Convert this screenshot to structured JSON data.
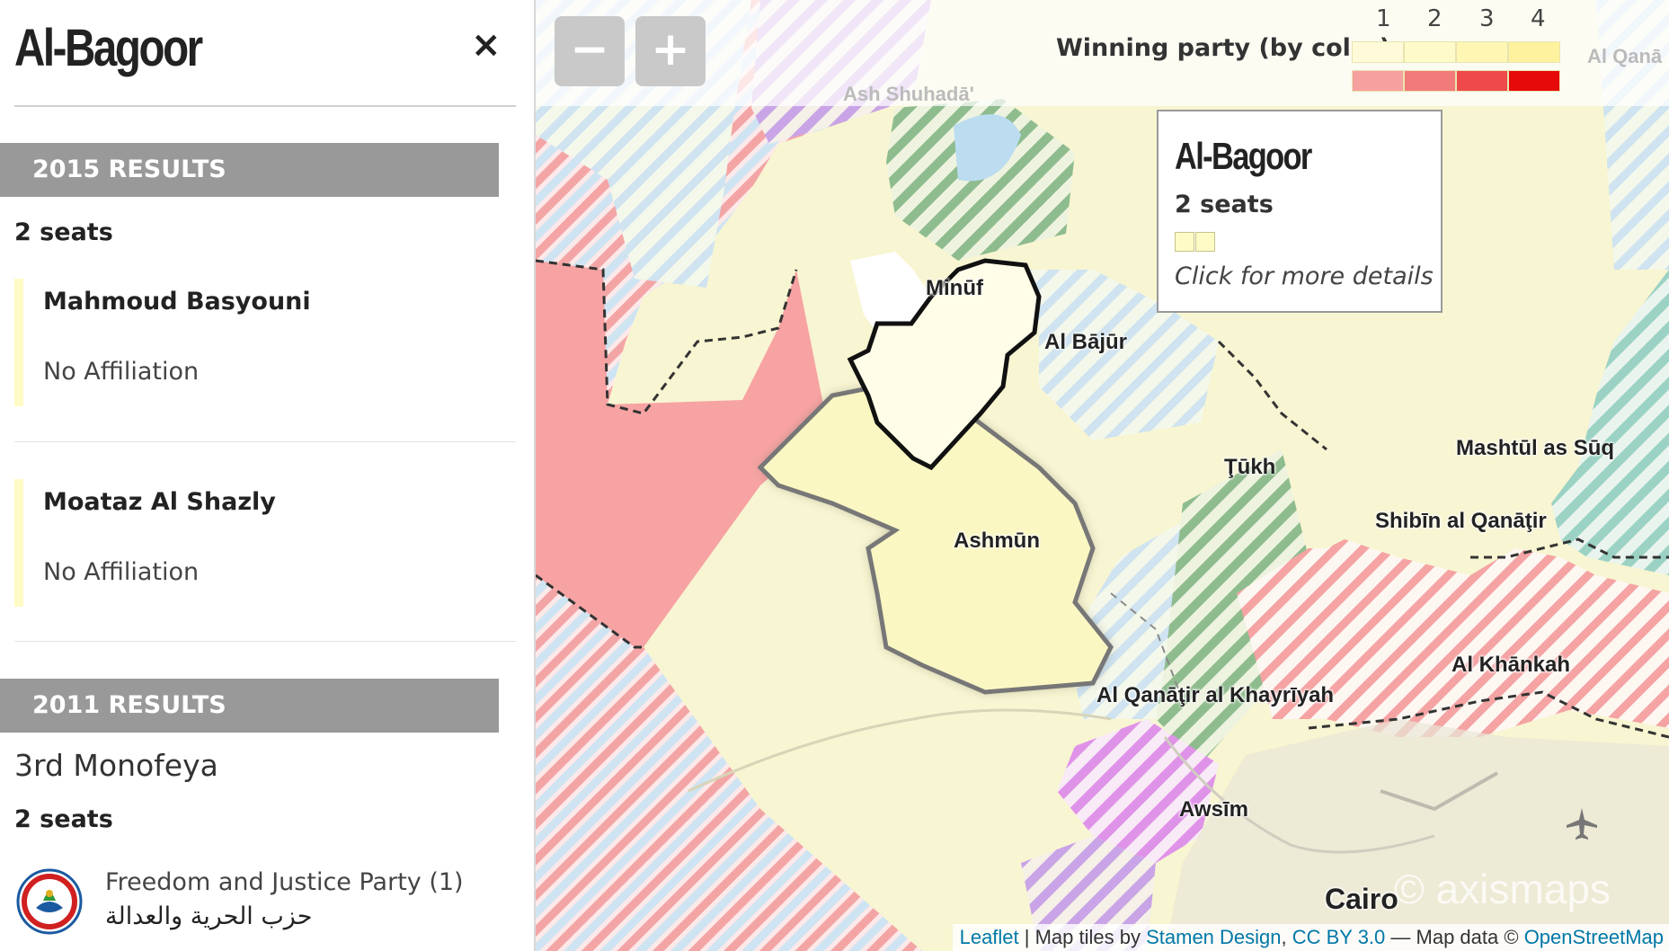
{
  "sidebar": {
    "title": "Al-Bagoor",
    "close_icon": "×",
    "results_2015": {
      "header": "2015 RESULTS",
      "seats": "2 seats",
      "candidates": [
        {
          "name": "Mahmoud Basyouni",
          "affiliation": "No Affiliation"
        },
        {
          "name": "Moataz Al Shazly",
          "affiliation": "No Affiliation"
        }
      ]
    },
    "results_2011": {
      "header": "2011 RESULTS",
      "district": "3rd Monofeya",
      "seats": "2 seats",
      "party_name": "Freedom and Justice Party (1)",
      "party_arabic": "حزب الحرية والعدالة"
    }
  },
  "map": {
    "zoom_out": "−",
    "zoom_in": "+",
    "legend": {
      "title": "Winning party (by color)",
      "numbers": [
        "1",
        "2",
        "3",
        "4"
      ],
      "colors_row1": [
        "#fffbd9",
        "#fffaca",
        "#fff6b4",
        "#fff29e"
      ],
      "colors_row2": [
        "#f7a0a0",
        "#f37a7a",
        "#ee4a4a",
        "#e60a0a"
      ]
    },
    "places": {
      "minuf": "Minūf",
      "al_bajur": "Al Bājūr",
      "tukh": "Ţūkh",
      "ashmun": "Ashmūn",
      "mashtul": "Mashtūl as Sūq",
      "shibin": "Shibīn al Qanāţir",
      "al_khankah": "Al Khānkah",
      "al_qanatir": "Al Qanāţir al Khayrīyah",
      "awsim": "Awsīm",
      "cairo": "Cairo",
      "ash_shuhada": "Ash Shuhadā'",
      "al_qana": "Al Qanā"
    },
    "tooltip": {
      "title": "Al-Bagoor",
      "seats": "2 seats",
      "hint": "Click for more details"
    },
    "attribution": {
      "leaflet": "Leaflet",
      "sep1": " | Map tiles by ",
      "stamen": "Stamen Design",
      "sep2": ", ",
      "cc": "CC BY 3.0",
      "sep3": " — Map data © ",
      "osm": "OpenStreetMap"
    },
    "watermark": "© axismaps",
    "airport_icon": "airplane-icon"
  }
}
